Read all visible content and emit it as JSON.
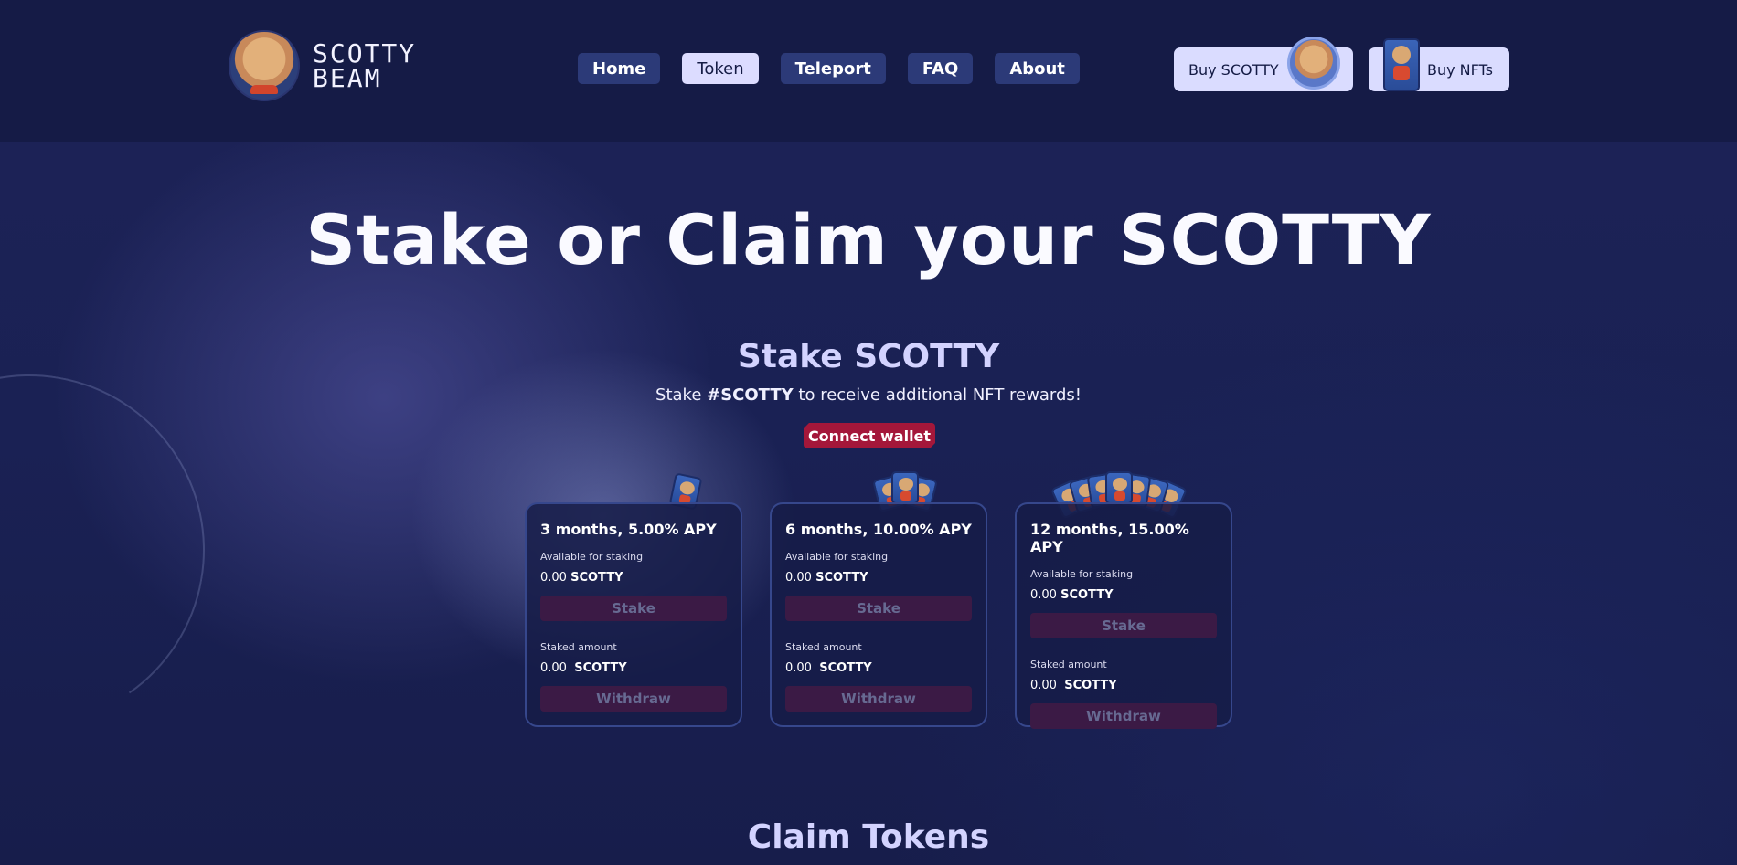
{
  "header": {
    "logo_line1": "SCOTTY",
    "logo_line2": "BEAM",
    "nav": [
      {
        "label": "Home",
        "active": false
      },
      {
        "label": "Token",
        "active": true
      },
      {
        "label": "Teleport",
        "active": false
      },
      {
        "label": "FAQ",
        "active": false
      },
      {
        "label": "About",
        "active": false
      }
    ],
    "buy_scotty_label": "Buy SCOTTY",
    "buy_nfts_label": "Buy NFTs"
  },
  "main": {
    "title": "Stake or Claim your SCOTTY",
    "stake_title": "Stake SCOTTY",
    "stake_sub_prefix": "Stake ",
    "stake_sub_bold": "#SCOTTY",
    "stake_sub_suffix": " to receive additional NFT rewards!",
    "connect_wallet_label": "Connect wallet",
    "claim_title": "Claim Tokens"
  },
  "staking_cards": [
    {
      "title": "3 months, 5.00% APY",
      "available_label": "Available for staking",
      "available_value": "0.00",
      "token": "SCOTTY",
      "stake_label": "Stake",
      "staked_label": "Staked amount",
      "staked_value": "0.00",
      "withdraw_label": "Withdraw",
      "nft_reward_count": 1
    },
    {
      "title": "6 months, 10.00% APY",
      "available_label": "Available for staking",
      "available_value": "0.00",
      "token": "SCOTTY",
      "stake_label": "Stake",
      "staked_label": "Staked amount",
      "staked_value": "0.00",
      "withdraw_label": "Withdraw",
      "nft_reward_count": 3
    },
    {
      "title": "12 months, 15.00% APY",
      "available_label": "Available for staking",
      "available_value": "0.00",
      "token": "SCOTTY",
      "stake_label": "Stake",
      "staked_label": "Staked amount",
      "staked_value": "0.00",
      "withdraw_label": "Withdraw",
      "nft_reward_count": 7
    }
  ],
  "colors": {
    "background": "#141b45",
    "nav_button": "#2c3a78",
    "nav_active": "#dcdcff",
    "connect_wallet": "#a4173a",
    "disabled_action": "#3b1a45",
    "card_border": "#36478c"
  },
  "icons": {
    "logo": "scotty-hamster-avatar-icon",
    "buy_scotty": "scotty-coin-avatar-icon",
    "buy_nfts": "nft-card-icon"
  }
}
